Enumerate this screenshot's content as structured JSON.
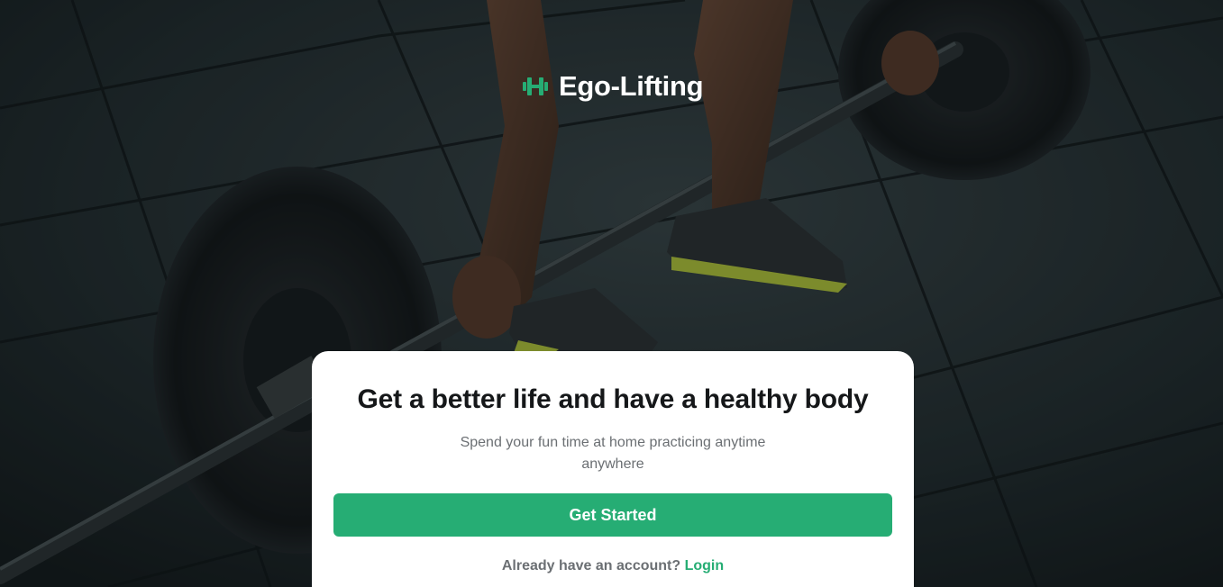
{
  "brand": {
    "name": "Ego-Lifting",
    "icon": "dumbbell-icon",
    "accent_color": "#26ad74"
  },
  "background": {
    "image": "barbell-deadlift-photo"
  },
  "card": {
    "title": "Get a better life and have a healthy body",
    "subtitle": "Spend your fun time at home practicing anytime anywhere",
    "cta_label": "Get Started",
    "login_prompt": "Already have an account?",
    "login_label": "Login"
  },
  "colors": {
    "primary": "#26ad74",
    "card_background": "#ffffff",
    "title_text": "#151719",
    "muted_text": "#6b6f73"
  }
}
